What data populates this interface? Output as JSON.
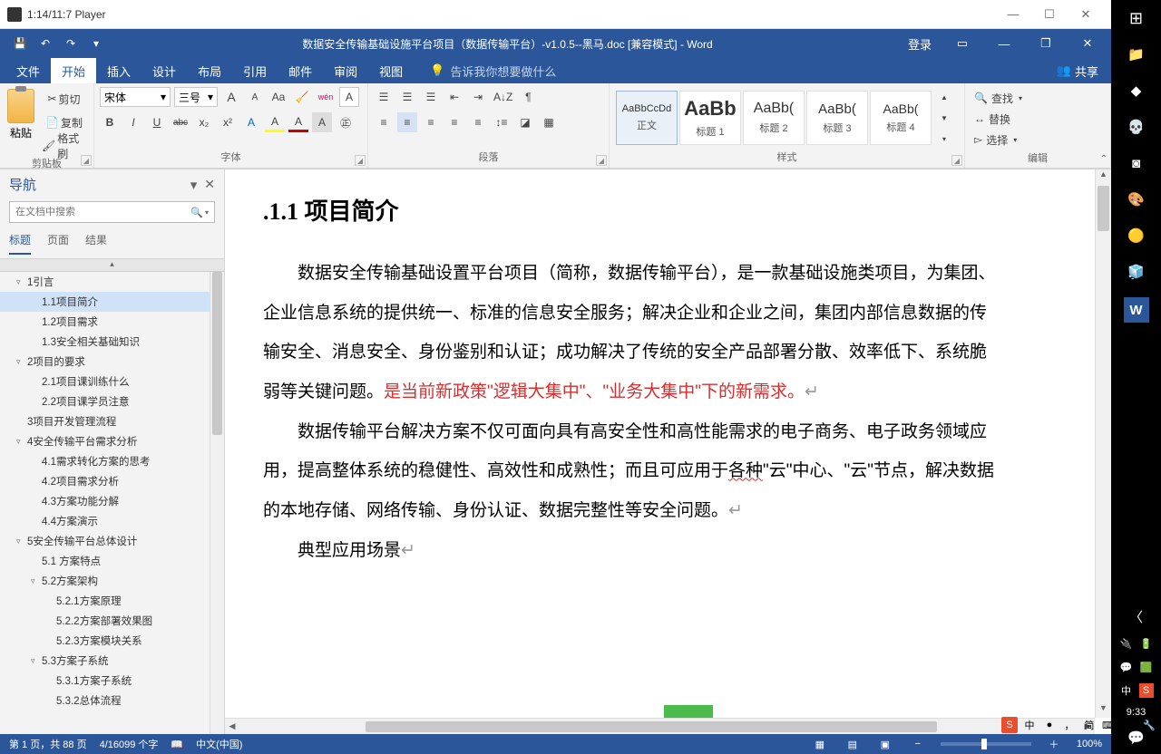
{
  "player": {
    "title": "1:14/11:7 Player",
    "min": "—",
    "max": "☐",
    "close": "✕"
  },
  "word_title": {
    "doc": "数据安全传输基础设施平台项目（数据传输平台）-v1.0.5--黑马.doc [兼容模式] - Word",
    "login": "登录",
    "qat_save": "💾",
    "qat_undo": "↶",
    "qat_redo": "↷",
    "qat_more": "▾"
  },
  "tabs": {
    "file": "文件",
    "home": "开始",
    "insert": "插入",
    "design": "设计",
    "layout": "布局",
    "references": "引用",
    "mailings": "邮件",
    "review": "审阅",
    "view": "视图",
    "tell_placeholder": "告诉我你想要做什么",
    "tell_icon": "💡",
    "share": "共享",
    "share_icon": "👥"
  },
  "ribbon": {
    "clipboard": {
      "paste": "粘贴",
      "cut": "剪切",
      "copy": "复制",
      "fmt": "格式刷",
      "label": "剪贴板",
      "cut_icon": "✂"
    },
    "font": {
      "name": "宋体",
      "size": "三号",
      "grow": "A",
      "shrink": "A",
      "aa": "Aa",
      "clr": "🧹",
      "wen": "wén",
      "box": "A",
      "bold": "B",
      "italic": "I",
      "underline": "U",
      "strike": "abc",
      "sub": "x₂",
      "sup": "x²",
      "text_eff": "A",
      "hl": "A",
      "color": "A",
      "circle": "A",
      "ring": "㊣",
      "label": "字体"
    },
    "para": {
      "bullets": "☰",
      "numbers": "☰",
      "multi": "☰",
      "outdent": "⇤",
      "indent": "⇥",
      "sort": "A↓Z",
      "show": "¶",
      "al1": "≡",
      "al2": "≡",
      "al3": "≡",
      "al4": "≡",
      "al5": "≡",
      "line": "↕≡",
      "fill": "◪",
      "border": "▦",
      "label": "段落"
    },
    "styles": {
      "s1": {
        "prev": "AaBbCcDd",
        "lbl": "正文"
      },
      "s2": {
        "prev": "AaBb",
        "lbl": "标题 1"
      },
      "s3": {
        "prev": "AaBb(",
        "lbl": "标题 2"
      },
      "s4": {
        "prev": "AaBb(",
        "lbl": "标题 3"
      },
      "s5": {
        "prev": "AaBb(",
        "lbl": "标题 4"
      },
      "label": "样式"
    },
    "editing": {
      "find": "查找",
      "replace": "替换",
      "select": "选择",
      "find_icon": "🔍",
      "replace_icon": "↔",
      "select_icon": "▻",
      "label": "编辑"
    }
  },
  "nav": {
    "title": "导航",
    "dd": "▾",
    "close": "✕",
    "search_placeholder": "在文档中搜索",
    "search_icon": "🔍",
    "tabs": {
      "headings": "标题",
      "pages": "页面",
      "results": "结果"
    },
    "expand": "▴",
    "tree": [
      {
        "lv": 1,
        "exp": "▿",
        "txt": "1引言"
      },
      {
        "lv": 2,
        "txt": "1.1项目简介",
        "sel": true
      },
      {
        "lv": 2,
        "txt": "1.2项目需求"
      },
      {
        "lv": 2,
        "txt": "1.3安全相关基础知识"
      },
      {
        "lv": 1,
        "exp": "▿",
        "txt": "2项目的要求"
      },
      {
        "lv": 2,
        "txt": "2.1项目课训练什么"
      },
      {
        "lv": 2,
        "txt": "2.2项目课学员注意"
      },
      {
        "lv": 1,
        "txt": "3项目开发管理流程"
      },
      {
        "lv": 1,
        "exp": "▿",
        "txt": "4安全传输平台需求分析"
      },
      {
        "lv": 2,
        "txt": "4.1需求转化方案的思考"
      },
      {
        "lv": 2,
        "txt": "4.2项目需求分析"
      },
      {
        "lv": 2,
        "txt": "4.3方案功能分解"
      },
      {
        "lv": 2,
        "txt": "4.4方案演示"
      },
      {
        "lv": 1,
        "exp": "▿",
        "txt": "5安全传输平台总体设计"
      },
      {
        "lv": 2,
        "txt": "5.1 方案特点"
      },
      {
        "lv": 2,
        "exp": "▿",
        "txt": "5.2方案架构"
      },
      {
        "lv": 3,
        "txt": "5.2.1方案原理"
      },
      {
        "lv": 3,
        "txt": "5.2.2方案部署效果图"
      },
      {
        "lv": 3,
        "txt": "5.2.3方案模块关系"
      },
      {
        "lv": 2,
        "exp": "▿",
        "txt": "5.3方案子系统"
      },
      {
        "lv": 3,
        "txt": "5.3.1方案子系统"
      },
      {
        "lv": 3,
        "txt": "5.3.2总体流程"
      }
    ]
  },
  "doc": {
    "heading": ".1.1 项目简介",
    "p1a": "数据安全传输基础设置平台项目（简称，数据传输平台），是一款基础设施类项目，为集团、企业信息系统的提供统一、标准的信息安全服务；解决企业和企业之间，集团内部信息数据的传输安全、消息安全、身份鉴别和认证；成功解决了传统的安全产品部署分散、效率低下、系统脆弱等关键问题。",
    "p1red": "是当前新政策\"逻辑大集中\"、\"业务大集中\"下的新需求。",
    "p2a": "数据传输平台解决方案不仅可面向具有高安全性和高性能需求的电子商务、电子政务领域应用，提高整体系统的稳健性、高效性和成熟性；而且可应用于",
    "p2u": "各种",
    "p2b": "\"云\"中心、\"云\"节点，解决数据的本地存储、网络传输、身份认证、数据完整性等安全问题。",
    "p3": "典型应用场景"
  },
  "status": {
    "page": "第 1 页，共 88 页",
    "words": "4/16099 个字",
    "book": "📖",
    "lang": "中文(中国)",
    "v1": "▦",
    "v2": "▤",
    "v3": "▣",
    "v4": "▭",
    "minus": "−",
    "plus": "＋",
    "zoom": "100%"
  },
  "ime": {
    "s": "S",
    "zh": "中",
    "dot": "●",
    "comma": "，",
    "sim": "简",
    "kb": "⌨",
    "gear": "⚙",
    "tool": "🔧"
  },
  "taskbar": {
    "items": [
      "⊞",
      "📁",
      "◆",
      "💀",
      "◙",
      "🎨",
      "🟡",
      "🧊"
    ],
    "word": "W",
    "up": "〈",
    "b1": "🔌",
    "b2": "🔋",
    "b3": "💬",
    "b4": "🟩",
    "zh": "中",
    "s": "S",
    "clock": "9:33",
    "bubble": "💬"
  }
}
